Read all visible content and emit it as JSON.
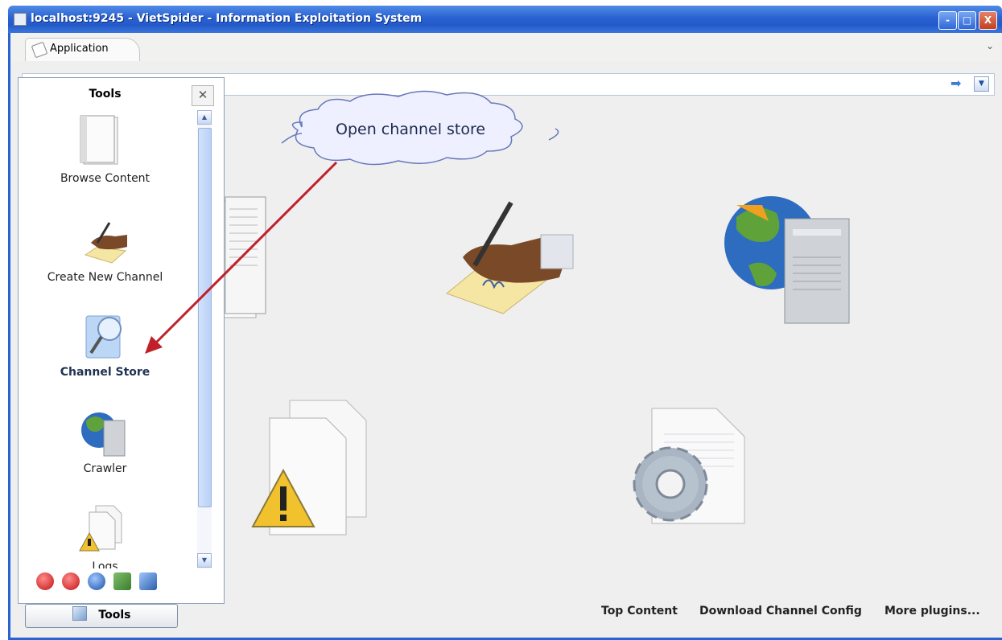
{
  "window": {
    "title": "localhost:9245 - VietSpider - Information Exploitation System",
    "controls": {
      "minimize": "-",
      "maximize": "□",
      "close": "X"
    }
  },
  "tabs": [
    {
      "label": "Application"
    }
  ],
  "tools_panel": {
    "title": "Tools",
    "items": [
      {
        "label": "Browse Content",
        "icon": "browse-content-icon"
      },
      {
        "label": "Create New Channel",
        "icon": "create-channel-icon"
      },
      {
        "label": "Channel Store",
        "icon": "channel-store-icon",
        "selected": true
      },
      {
        "label": "Crawler",
        "icon": "crawler-icon"
      },
      {
        "label": "Logs",
        "icon": "logs-icon"
      }
    ],
    "bottom_icons": [
      "shutdown-icon",
      "stop-icon",
      "info-icon",
      "users-icon",
      "network-icon"
    ]
  },
  "tools_button": {
    "label": "Tools"
  },
  "annotation": {
    "text": "Open channel store"
  },
  "footer_links": [
    "Top Content",
    "Download Channel Config",
    "More plugins..."
  ],
  "colors": {
    "titlebar": "#2a62d3",
    "panel_border": "#8ca0bb",
    "arrow": "#c0202a",
    "window_bg": "#efefef"
  }
}
